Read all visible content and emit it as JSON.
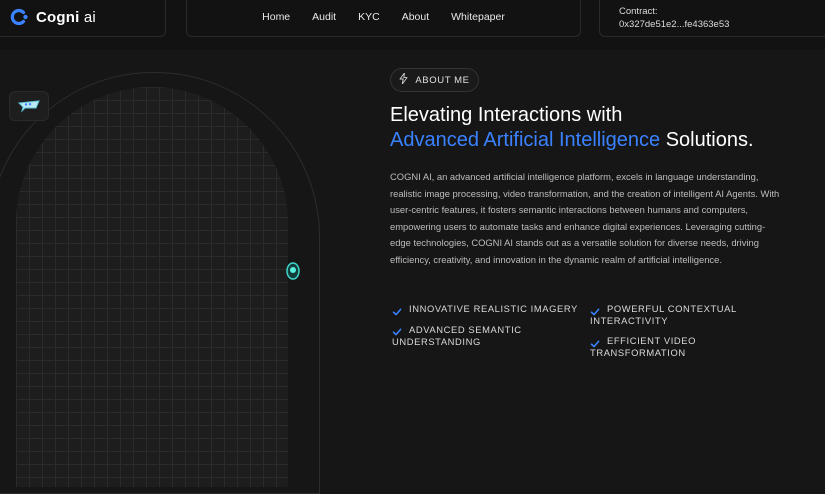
{
  "colors": {
    "accent": "#3a82ff",
    "background": "#161616",
    "text": "#ffffff"
  },
  "header": {
    "logo": {
      "name": "Cogni",
      "suffix": "ai",
      "icon": "cogni-logo-icon"
    },
    "nav": [
      "Home",
      "Audit",
      "KYC",
      "About",
      "Whitepaper"
    ],
    "contract": {
      "label": "Contract:",
      "address": "0x327de51e2...fe4363e53"
    }
  },
  "about": {
    "badge": {
      "icon": "lightning-icon",
      "label": "ABOUT ME"
    },
    "headline": {
      "line1": "Elevating Interactions with",
      "accent": "Advanced Artificial Intelligence",
      "tail": " Solutions."
    },
    "description": "COGNI AI, an advanced artificial intelligence platform, excels in language understanding, realistic image processing, video transformation, and the creation of intelligent AI Agents. With user-centric features, it fosters semantic interactions between humans and computers, empowering users to automate tasks and enhance digital experiences. Leveraging cutting-edge technologies, COGNI AI stands out as a versatile solution for diverse needs, driving efficiency, creativity, and innovation in the dynamic realm of artificial intelligence.",
    "features": [
      {
        "line1": "INNOVATIVE REALISTIC IMAGERY",
        "line2": ""
      },
      {
        "line1": "POWERFUL CONTEXTUAL",
        "line2": "INTERACTIVITY"
      },
      {
        "line1": "ADVANCED SEMANTIC",
        "line2": "UNDERSTANDING"
      },
      {
        "line1": "EFFICIENT VIDEO",
        "line2": "TRANSFORMATION"
      }
    ]
  }
}
